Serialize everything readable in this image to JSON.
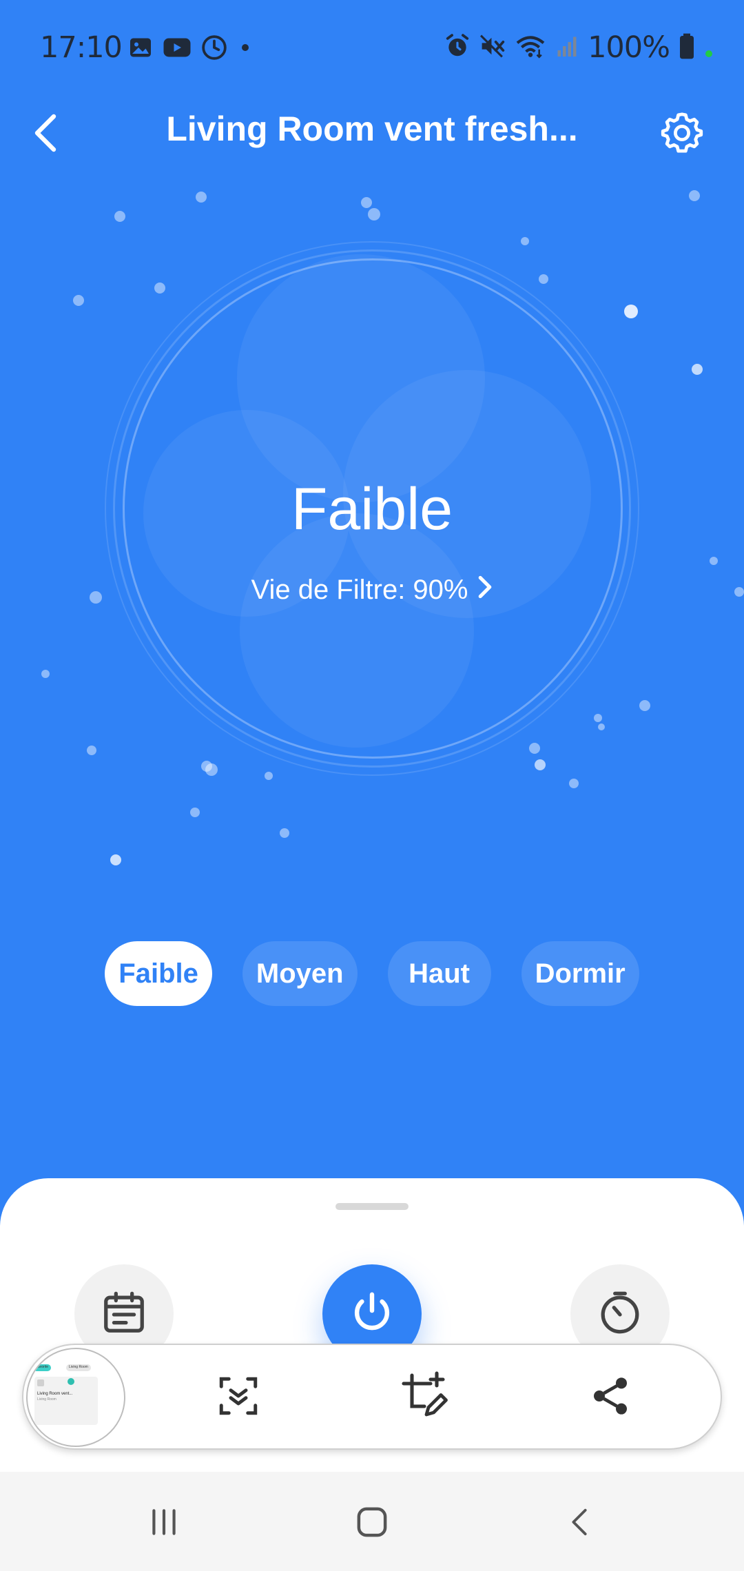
{
  "status_bar": {
    "time": "17:10",
    "left_icons": [
      "gallery-icon",
      "youtube-icon",
      "clock-icon",
      "dot-icon"
    ],
    "right_icons": [
      "alarm-icon",
      "mute-icon",
      "wifi-icon",
      "signal-icon",
      "battery-icon"
    ],
    "battery": "100%"
  },
  "app_bar": {
    "title": "Living Room vent fresh...",
    "back_icon": "back-arrow-icon",
    "settings_icon": "gear-icon"
  },
  "dial": {
    "current_mode": "Faible",
    "filter_label": "Vie de Filtre: 90%"
  },
  "modes": {
    "items": [
      {
        "label": "Faible",
        "active": true
      },
      {
        "label": "Moyen",
        "active": false
      },
      {
        "label": "Haut",
        "active": false
      },
      {
        "label": "Dormir",
        "active": false
      }
    ]
  },
  "bottom_sheet": {
    "actions": [
      "schedule-icon",
      "power-icon",
      "timer-icon"
    ]
  },
  "screenshot_toolbar": {
    "thumbnail_chips": [
      "Favorite",
      "Living Room"
    ],
    "thumbnail_title": "Living Room vent...",
    "thumbnail_subtitle": "Living Room",
    "tools": [
      "scroll-capture-icon",
      "crop-edit-icon",
      "share-icon"
    ]
  },
  "nav_bar": {
    "buttons": [
      "recents-icon",
      "home-icon",
      "back-icon"
    ]
  },
  "colors": {
    "primary": "#3082F6",
    "white": "#FFFFFF",
    "icon_dark": "#444444"
  }
}
